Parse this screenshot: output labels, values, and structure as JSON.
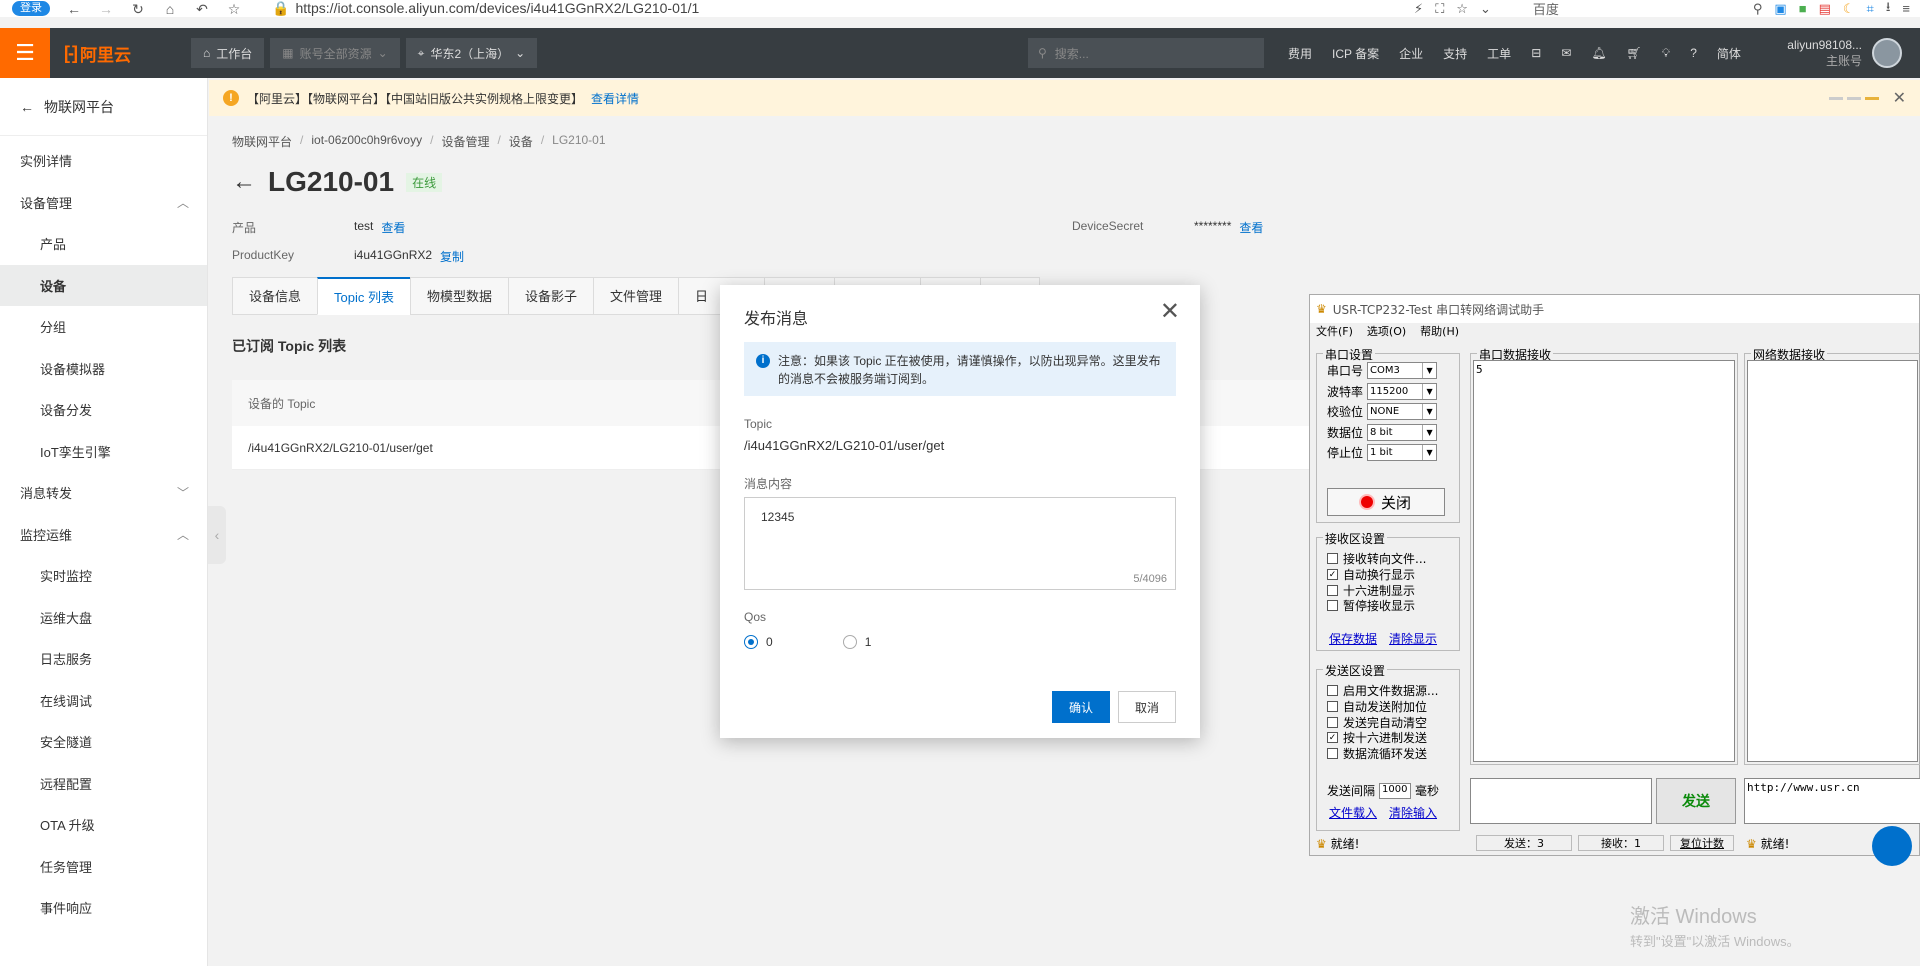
{
  "browser": {
    "login": "登录",
    "url": "https://iot.console.aliyun.com/devices/i4u41GGnRX2/LG210-01/1",
    "search_engine": "百度"
  },
  "topnav": {
    "logo": "阿里云",
    "workbench": "工作台",
    "account": "账号全部资源",
    "region": "华东2（上海）",
    "search_placeholder": "搜索...",
    "links": [
      "费用",
      "ICP 备案",
      "企业",
      "支持",
      "工单"
    ],
    "lang": "简体",
    "user": "aliyun98108...",
    "user_role": "主账号"
  },
  "notice": {
    "text": "【阿里云】【物联网平台】【中国站旧版公共实例规格上限变更】",
    "link": "查看详情"
  },
  "sidebar": {
    "back": "物联网平台",
    "items": [
      {
        "label": "实例详情",
        "sub": false,
        "chev": ""
      },
      {
        "label": "设备管理",
        "sub": false,
        "chev": "︿"
      },
      {
        "label": "产品",
        "sub": true,
        "chev": ""
      },
      {
        "label": "设备",
        "sub": true,
        "chev": "",
        "active": true
      },
      {
        "label": "分组",
        "sub": true,
        "chev": ""
      },
      {
        "label": "设备模拟器",
        "sub": true,
        "chev": ""
      },
      {
        "label": "设备分发",
        "sub": true,
        "chev": ""
      },
      {
        "label": "IoT孪生引擎",
        "sub": true,
        "chev": ""
      },
      {
        "label": "消息转发",
        "sub": false,
        "chev": "﹀"
      },
      {
        "label": "监控运维",
        "sub": false,
        "chev": "︿"
      },
      {
        "label": "实时监控",
        "sub": true,
        "chev": ""
      },
      {
        "label": "运维大盘",
        "sub": true,
        "chev": ""
      },
      {
        "label": "日志服务",
        "sub": true,
        "chev": ""
      },
      {
        "label": "在线调试",
        "sub": true,
        "chev": ""
      },
      {
        "label": "安全隧道",
        "sub": true,
        "chev": ""
      },
      {
        "label": "远程配置",
        "sub": true,
        "chev": ""
      },
      {
        "label": "OTA 升级",
        "sub": true,
        "chev": ""
      },
      {
        "label": "任务管理",
        "sub": true,
        "chev": ""
      },
      {
        "label": "事件响应",
        "sub": true,
        "chev": ""
      }
    ]
  },
  "breadcrumb": [
    "物联网平台",
    "iot-06z00c0h9r6voyy",
    "设备管理",
    "设备",
    "LG210-01"
  ],
  "device": {
    "name": "LG210-01",
    "status": "在线",
    "product_label": "产品",
    "product_value": "test",
    "view": "查看",
    "productkey_label": "ProductKey",
    "productkey_value": "i4u41GGnRX2",
    "copy": "复制",
    "secret_label": "DeviceSecret",
    "secret_value": "********"
  },
  "tabs": [
    "设备信息",
    "Topic 列表",
    "物模型数据",
    "设备影子",
    "文件管理",
    "日",
    "",
    "",
    "",
    ""
  ],
  "topic_list": {
    "title": "已订阅 Topic 列表",
    "header": "设备的 Topic",
    "rows": [
      "/i4u41GGnRX2/LG210-01/user/get"
    ]
  },
  "modal": {
    "title": "发布消息",
    "alert": "注意：如果该 Topic 正在被使用，请谨慎操作，以防出现异常。这里发布的消息不会被服务端订阅到。",
    "topic_label": "Topic",
    "topic_value": "/i4u41GGnRX2/LG210-01/user/get",
    "content_label": "消息内容",
    "content_value": "12345",
    "content_count": "5/4096",
    "qos_label": "Qos",
    "qos_options": [
      "0",
      "1"
    ],
    "qos_selected": "0",
    "ok": "确认",
    "cancel": "取消"
  },
  "usr": {
    "title": "USR-TCP232-Test 串口转网络调试助手",
    "menu": [
      "文件(F)",
      "选项(O)",
      "帮助(H)"
    ],
    "serial_group": "串口设置",
    "serial_rows": [
      {
        "label": "串口号",
        "value": "COM3"
      },
      {
        "label": "波特率",
        "value": "115200"
      },
      {
        "label": "校验位",
        "value": "NONE"
      },
      {
        "label": "数据位",
        "value": "8 bit"
      },
      {
        "label": "停止位",
        "value": "1 bit"
      }
    ],
    "close_btn": "关闭",
    "recv_group": "接收区设置",
    "recv_checks": [
      {
        "label": "接收转向文件...",
        "checked": false
      },
      {
        "label": "自动换行显示",
        "checked": true
      },
      {
        "label": "十六进制显示",
        "checked": false
      },
      {
        "label": "暂停接收显示",
        "checked": false
      }
    ],
    "save_data": "保存数据",
    "clear_display": "清除显示",
    "send_group": "发送区设置",
    "send_checks": [
      {
        "label": "启用文件数据源...",
        "checked": false
      },
      {
        "label": "自动发送附加位",
        "checked": false
      },
      {
        "label": "发送完自动清空",
        "checked": false
      },
      {
        "label": "按十六进制发送",
        "checked": true
      },
      {
        "label": "数据流循环发送",
        "checked": false
      }
    ],
    "interval_label": "发送间隔",
    "interval_value": "1000",
    "interval_unit": "毫秒",
    "file_load": "文件载入",
    "clear_input": "清除输入",
    "serial_recv_label": "串口数据接收",
    "serial_recv_content": "5",
    "net_recv_label": "网络数据接收",
    "send_btn": "发送",
    "net_send_content": "http://www.usr.cn",
    "status_ready": "就绪!",
    "sent": "发送：3",
    "received": "接收：1",
    "reset_count": "复位计数",
    "status_ready2": "就绪!"
  },
  "watermark": {
    "line1": "激活 Windows",
    "line2": "转到\"设置\"以激活 Windows。"
  }
}
